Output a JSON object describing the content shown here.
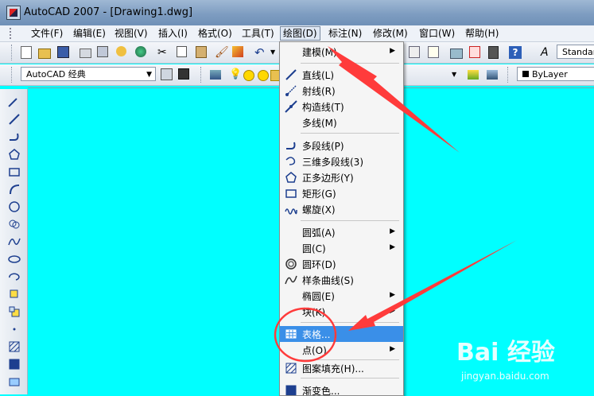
{
  "window": {
    "title": "AutoCAD 2007 - [Drawing1.dwg]"
  },
  "menubar": {
    "items": [
      {
        "label": "文件(F)"
      },
      {
        "label": "编辑(E)"
      },
      {
        "label": "视图(V)"
      },
      {
        "label": "插入(I)"
      },
      {
        "label": "格式(O)"
      },
      {
        "label": "工具(T)"
      },
      {
        "label": "绘图(D)"
      },
      {
        "label": "标注(N)"
      },
      {
        "label": "修改(M)"
      },
      {
        "label": "窗口(W)"
      },
      {
        "label": "帮助(H)"
      }
    ]
  },
  "toolbar": {
    "text_style": "Standar",
    "workspace": "AutoCAD 经典",
    "layer": "",
    "color": "ByLayer"
  },
  "draw_menu": {
    "items": [
      {
        "label": "建模(M)"
      },
      {
        "label": "直线(L)"
      },
      {
        "label": "射线(R)"
      },
      {
        "label": "构造线(T)"
      },
      {
        "label": "多线(M)"
      },
      {
        "label": "多段线(P)"
      },
      {
        "label": "三维多段线(3)"
      },
      {
        "label": "正多边形(Y)"
      },
      {
        "label": "矩形(G)"
      },
      {
        "label": "螺旋(X)"
      },
      {
        "label": "圆弧(A)"
      },
      {
        "label": "圆(C)"
      },
      {
        "label": "圆环(D)"
      },
      {
        "label": "样条曲线(S)"
      },
      {
        "label": "椭圆(E)"
      },
      {
        "label": "块(K)"
      },
      {
        "label": "表格..."
      },
      {
        "label": "点(O)"
      },
      {
        "label": "图案填充(H)..."
      },
      {
        "label": "渐变色..."
      }
    ],
    "highlighted": "表格..."
  },
  "colors": {
    "canvas": "#00ffff",
    "highlight": "#3a8fe8",
    "annotation": "#ff3b3b"
  },
  "watermark": {
    "brand": "Bai 经验",
    "url": "jingyan.baidu.com"
  }
}
